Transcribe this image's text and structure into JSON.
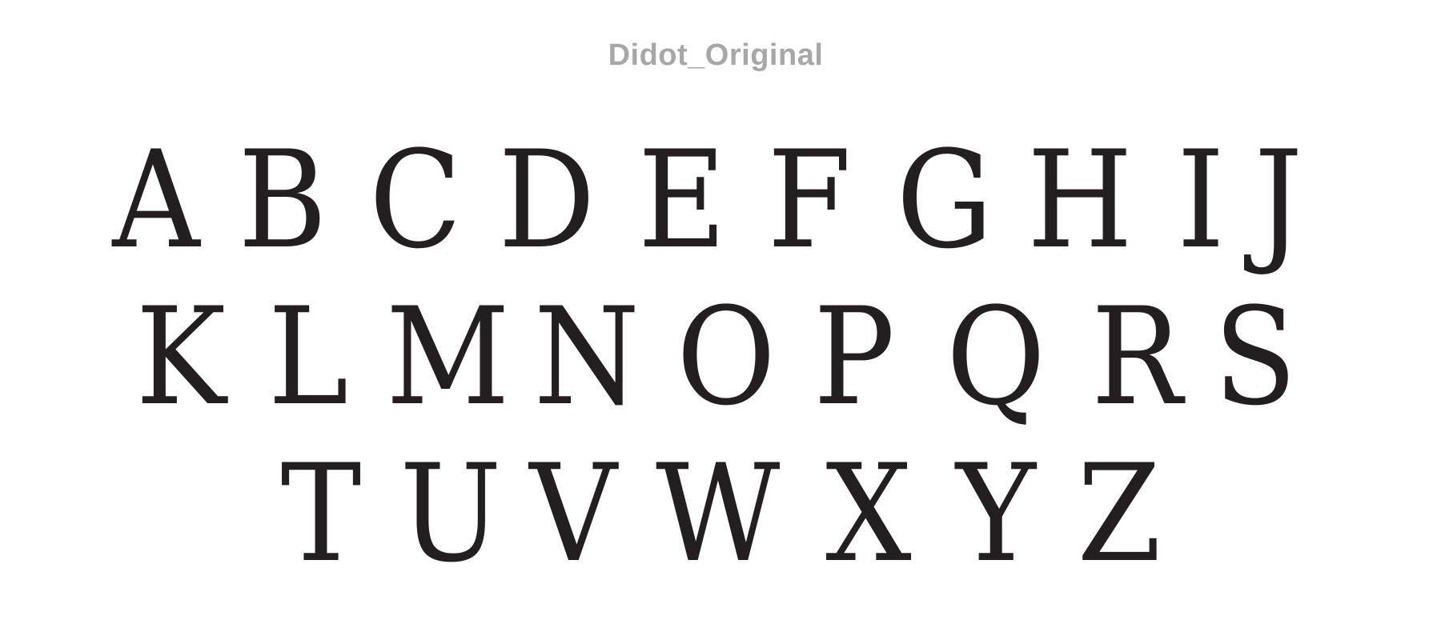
{
  "title": "Didot_Original",
  "colors": {
    "title": "#a7a7a7",
    "glyph": "#231f20",
    "background": "#ffffff"
  },
  "rows": [
    [
      "A",
      "B",
      "C",
      "D",
      "E",
      "F",
      "G",
      "H",
      "I",
      "J"
    ],
    [
      "K",
      "L",
      "M",
      "N",
      "O",
      "P",
      "Q",
      "R",
      "S"
    ],
    [
      "T",
      "U",
      "V",
      "W",
      "X",
      "Y",
      "Z"
    ]
  ]
}
